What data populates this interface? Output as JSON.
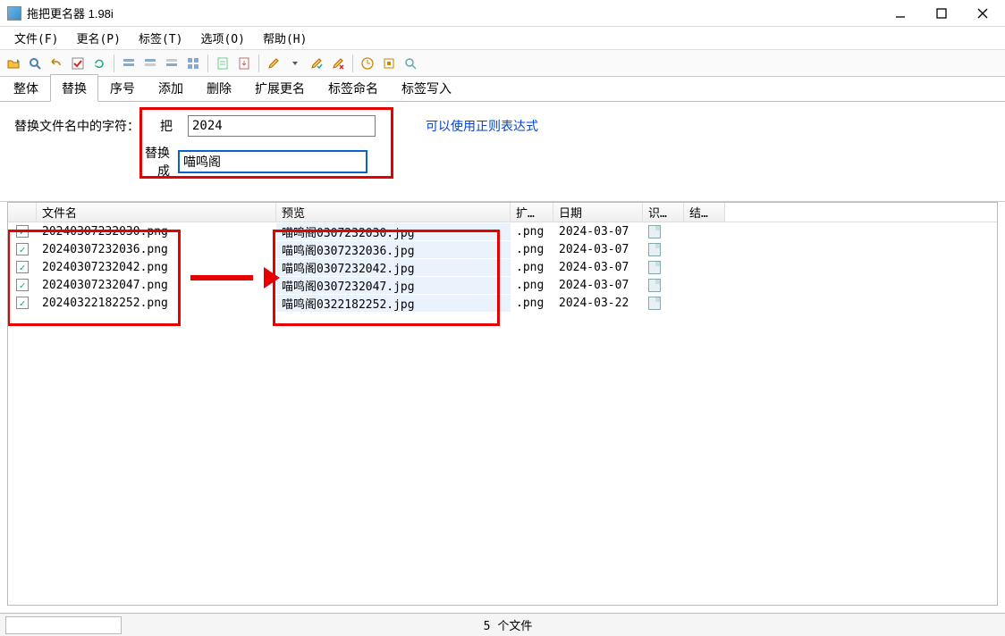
{
  "title": "拖把更名器 1.98i",
  "menubar": [
    "文件(F)",
    "更名(P)",
    "标签(T)",
    "选项(O)",
    "帮助(H)"
  ],
  "tabs": [
    "整体",
    "替换",
    "序号",
    "添加",
    "删除",
    "扩展更名",
    "标签命名",
    "标签写入"
  ],
  "active_tab": 1,
  "panel": {
    "header_label": "替换文件名中的字符：",
    "from_label": "把",
    "to_label": "替换成",
    "from_value": "2024",
    "to_value": "喵鸣阁",
    "regex_text": "可以使用正则表达式"
  },
  "columns": {
    "name": "文件名",
    "preview": "预览",
    "ext": "扩…",
    "date": "日期",
    "rec": "识…",
    "res": "结…"
  },
  "rows": [
    {
      "name": "20240307232030.png",
      "preview": "喵鸣阁0307232030.jpg",
      "ext": ".png",
      "date": "2024-03-07"
    },
    {
      "name": "20240307232036.png",
      "preview": "喵鸣阁0307232036.jpg",
      "ext": ".png",
      "date": "2024-03-07"
    },
    {
      "name": "20240307232042.png",
      "preview": "喵鸣阁0307232042.jpg",
      "ext": ".png",
      "date": "2024-03-07"
    },
    {
      "name": "20240307232047.png",
      "preview": "喵鸣阁0307232047.jpg",
      "ext": ".png",
      "date": "2024-03-07"
    },
    {
      "name": "20240322182252.png",
      "preview": "喵鸣阁0322182252.jpg",
      "ext": ".png",
      "date": "2024-03-22"
    }
  ],
  "status": {
    "text": "5 个文件"
  }
}
